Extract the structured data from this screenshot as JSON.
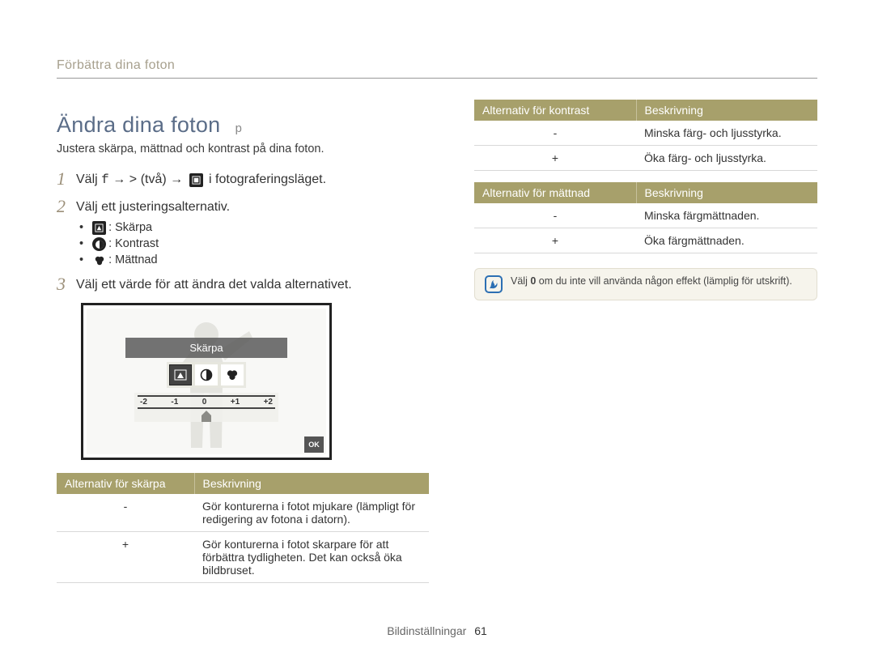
{
  "breadcrumb": "Förbättra dina foton",
  "title": "Ändra dina foton",
  "title_suffix": "p",
  "subheading": "Justera skärpa, mättnad och kontrast på dina foton.",
  "steps": {
    "s1": {
      "num": "1",
      "pre": "Välj ",
      "ftoken": "f",
      "arrow1": " → ",
      "gt": ">",
      "twice": " (två) ",
      "arrow2": "→ ",
      "post": " i fotograferingsläget."
    },
    "s2": {
      "num": "2",
      "text": "Välj ett justeringsalternativ.",
      "bullets": [
        {
          "label": ": Skärpa"
        },
        {
          "label": ": Kontrast"
        },
        {
          "label": ": Mättnad"
        }
      ]
    },
    "s3": {
      "num": "3",
      "text": "Välj ett värde för att ändra det valda alternativet."
    }
  },
  "lcd": {
    "label": "Skärpa",
    "ticks": [
      "-2",
      "-1",
      "0",
      "+1",
      "+2"
    ],
    "ok": "OK"
  },
  "tables": {
    "sharpness": {
      "headers": [
        "Alternativ för skärpa",
        "Beskrivning"
      ],
      "rows": [
        {
          "sym": "-",
          "desc": "Gör konturerna i fotot mjukare (lämpligt för redigering av fotona i datorn)."
        },
        {
          "sym": "+",
          "desc": "Gör konturerna i fotot skarpare för att förbättra tydligheten. Det kan också öka bildbruset."
        }
      ]
    },
    "contrast": {
      "headers": [
        "Alternativ för kontrast",
        "Beskrivning"
      ],
      "rows": [
        {
          "sym": "-",
          "desc": "Minska färg- och ljusstyrka."
        },
        {
          "sym": "+",
          "desc": "Öka färg- och ljusstyrka."
        }
      ]
    },
    "saturation": {
      "headers": [
        "Alternativ för mättnad",
        "Beskrivning"
      ],
      "rows": [
        {
          "sym": "-",
          "desc": "Minska färgmättnaden."
        },
        {
          "sym": "+",
          "desc": "Öka färgmättnaden."
        }
      ]
    }
  },
  "note": {
    "pre": "Välj ",
    "zero": "0",
    "post": " om du inte vill använda någon effekt (lämplig för utskrift)."
  },
  "footer": {
    "section": "Bildinställningar",
    "page": "61"
  }
}
